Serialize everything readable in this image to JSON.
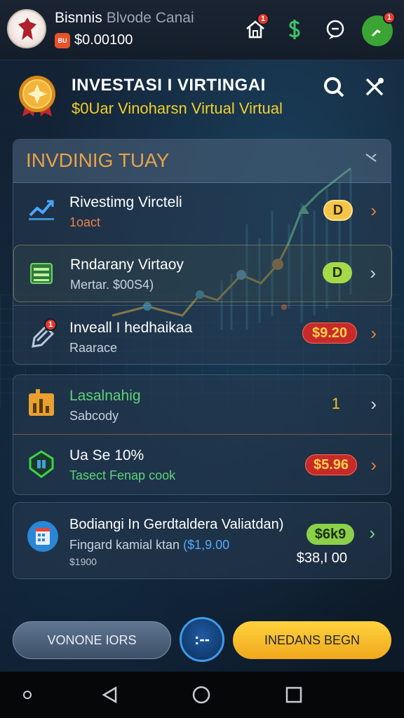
{
  "topbar": {
    "app_name": "Bisnnis",
    "app_name_dim": "Blvode Canai",
    "balance_badge": "BU",
    "balance": "$0.00100",
    "notif_count_home": "1",
    "notif_count_right": "1"
  },
  "header": {
    "title": "INVESTASI I VIRTINGAI",
    "subtitle": "$0Uar Vinoharsn Virtual Virtual"
  },
  "trading_panel": {
    "title": "INVDINIG TUAY",
    "rows": [
      {
        "title": "Rivestimg Vircteli",
        "sub": "1oact",
        "badge": "D",
        "icon": "trend-chart-icon"
      },
      {
        "title": "Rndarany Virtaoy",
        "sub": "Mertar. $00S4)",
        "badge": "D",
        "icon": "money-stack-icon"
      },
      {
        "title": "Inveall I hedhaikaa",
        "sub": "Raarace",
        "badge": "$9.20",
        "icon": "link-icon",
        "notif": "1"
      }
    ]
  },
  "panel2": {
    "rows": [
      {
        "title": "Lasalnahig",
        "sub": "Sabcody",
        "value": "1",
        "icon": "bar-chart-icon"
      },
      {
        "title": "Ua Se 10%",
        "sub": "Tasect Fenap cook",
        "badge": "$5.96",
        "icon": "shield-icon"
      }
    ]
  },
  "panel3": {
    "title": "Bodiangi In Gerdtaldera Valiatdan)",
    "sub": "Fingard kamial ktan",
    "sub_value": "($1,9.00",
    "small": "$1900",
    "badge": "$6k9",
    "value": "$38,I 00"
  },
  "bottom": {
    "left_label": "VONONE IORS",
    "mid_label": ":--",
    "right_label": "INEDANS BEGN"
  },
  "colors": {
    "accent_gold": "#f2cf2a",
    "panel_title": "#e9a24a",
    "green": "#3aa535",
    "red_badge": "#e23a2e"
  }
}
